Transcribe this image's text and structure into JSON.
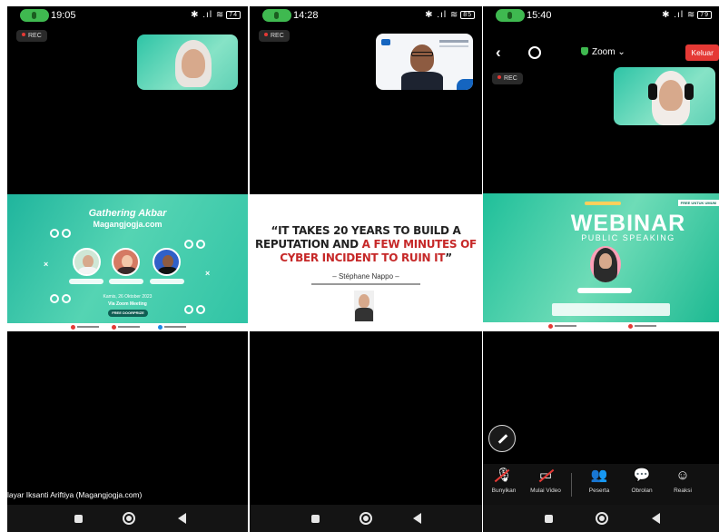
{
  "panels": [
    {
      "clock": "19:05",
      "status_icons": "✱ .ıl ≋",
      "battery": "74",
      "rec_label": "REC",
      "slide": {
        "title": "Gathering Akbar",
        "site": "Magangjogja.com",
        "date": "Kamis, 26 Oktober 2023",
        "via": "Via Zoom Meeting",
        "free": "FREE DOORPRIZE"
      },
      "caption": "layar Iksanti Ariftiya (Magangjogja.com)"
    },
    {
      "clock": "14:28",
      "status_icons": "✱ .ıl ≋",
      "battery": "85",
      "rec_label": "REC",
      "slide": {
        "quote_part1": "“IT TAKES 20 YEARS TO BUILD A REPUTATION AND ",
        "quote_part2": "A FEW MINUTES OF CYBER INCIDENT TO RUIN IT",
        "quote_part3": "”",
        "attribution": "– Stéphane Nappo –"
      }
    },
    {
      "clock": "15:40",
      "status_icons": "✱ .ıl ≋",
      "battery": "79",
      "rec_label": "REC",
      "header": {
        "zoom_label": "Zoom ⌄",
        "leave_label": "Keluar"
      },
      "slide": {
        "title": "WEBINAR",
        "subtitle": "PUBLIC SPEAKING",
        "free_tag": "FREE UNTUK UMUM"
      },
      "toolbar": [
        {
          "label": "Bunyikan",
          "icon": "microphone-muted-icon"
        },
        {
          "label": "Mulai Video",
          "icon": "video-off-icon"
        },
        {
          "label": "Peserta",
          "icon": "participants-icon"
        },
        {
          "label": "Obrolan",
          "icon": "chat-icon"
        },
        {
          "label": "Reaksi",
          "icon": "reaction-icon"
        }
      ]
    }
  ],
  "colors": {
    "call_pill": "#3fb950",
    "slide_teal": "#1fb59d",
    "leave_red": "#e53935",
    "quote_red": "#c62828"
  }
}
